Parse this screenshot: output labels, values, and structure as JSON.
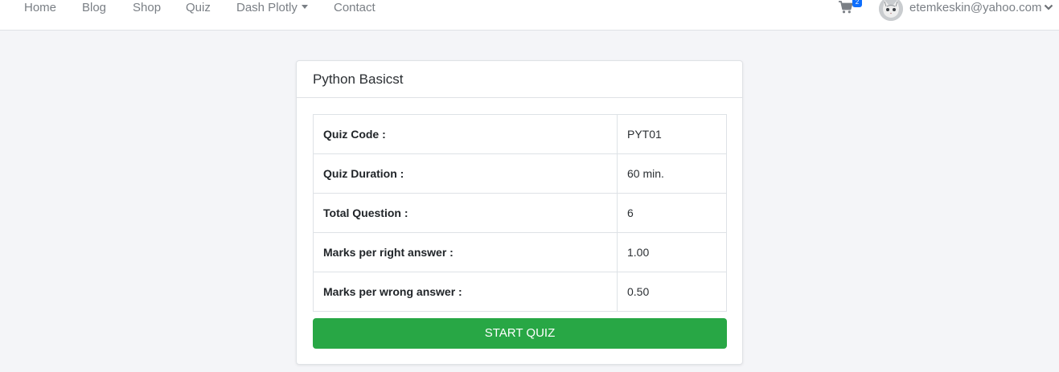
{
  "navbar": {
    "links": [
      "Home",
      "Blog",
      "Shop",
      "Quiz",
      "Dash Plotly",
      "Contact"
    ],
    "cart": {
      "icon": "shopping-cart-icon",
      "count": "2"
    },
    "user": {
      "email": "etemkeskin@yahoo.com"
    }
  },
  "card": {
    "title": "Python Basicst",
    "rows": [
      {
        "label": "Quiz Code :",
        "value": "PYT01"
      },
      {
        "label": "Quiz Duration :",
        "value": "60 min."
      },
      {
        "label": "Total Question :",
        "value": "6"
      },
      {
        "label": "Marks per right answer :",
        "value": "1.00"
      },
      {
        "label": "Marks per wrong answer :",
        "value": "0.50"
      }
    ],
    "start_button": "START QUIZ"
  },
  "colors": {
    "primary_button": "#28a745",
    "badge": "#0d6efd",
    "background": "#f4f5f8"
  }
}
